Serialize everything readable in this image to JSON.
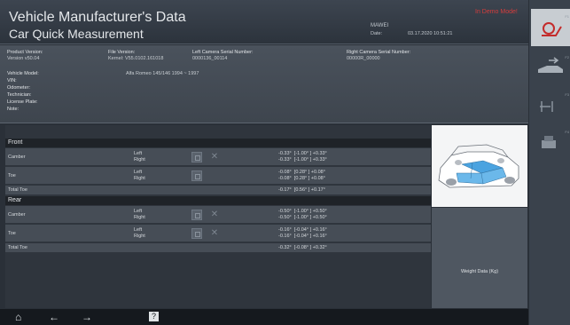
{
  "header": {
    "title_line1": "Vehicle Manufacturer's Data",
    "title_line2": "Car Quick Measurement",
    "demo_mode": "In Demo Mode!",
    "shop": "MAWEI",
    "date_label": "Date:",
    "date_value": "03.17.2020 10:51:21"
  },
  "info": {
    "product_version_label": "Product Version:",
    "product_version_value": "Version v50.04",
    "file_version_label": "File Version:",
    "file_version_value": "Kernel: V55.0102.161018",
    "left_camera_label": "Left Camera Serial Number:",
    "left_camera_value": "0000136_00114",
    "right_camera_label": "Right Camera Serial Number:",
    "right_camera_value": "00000R_00000",
    "vehicle_model_label": "Vehicle Model:",
    "vehicle_model_value": "Alfa Romeo  145/146  1994 ~ 1997",
    "vin_label": "VIN:",
    "odometer_label": "Odometer:",
    "technician_label": "Technician:",
    "license_label": "License Plate:",
    "note_label": "Note:"
  },
  "front": {
    "title": "Front",
    "camber_label": "Camber",
    "camber_left_side": "Left",
    "camber_right_side": "Right",
    "camber_left_val": "-0.33°  [-1.00° ] +0.33°",
    "camber_right_val": "-0.33°  [-1.00° ] +0.33°",
    "toe_label": "Toe",
    "toe_left_side": "Left",
    "toe_right_side": "Right",
    "toe_left_val": "-0.08°  [0.28° ] +0.08°",
    "toe_right_val": "-0.08°  [0.28° ] +0.08°",
    "total_toe_label": "Total Toe",
    "total_toe_val": "-0.17°  [0.56° ] +0.17°"
  },
  "rear": {
    "title": "Rear",
    "camber_label": "Camber",
    "camber_left_side": "Left",
    "camber_right_side": "Right",
    "camber_left_val": "-0.50°  [-1.00° ] +0.50°",
    "camber_right_val": "-0.50°  [-1.00° ] +0.50°",
    "toe_label": "Toe",
    "toe_left_side": "Left",
    "toe_right_side": "Right",
    "toe_left_val": "-0.16°  [-0.04° ] +0.16°",
    "toe_right_val": "-0.16°  [-0.04° ] +0.16°",
    "total_toe_label": "Total Toe",
    "total_toe_val": "-0.32°  [-0.08° ] +0.32°"
  },
  "weight_label": "Weight Data (Kg)",
  "sidebar": {
    "f1": "F1",
    "f2": "F2",
    "f3": "F3",
    "f4": "F4"
  },
  "colors": {
    "accent_red": "#d63c3c",
    "car_highlight": "#4aa3e0"
  },
  "icons": {
    "home": "home-icon",
    "back": "arrow-left-icon",
    "forward": "arrow-right-icon",
    "help": "help-icon",
    "wheel": "wheel-icon",
    "swap": "swap-cars-icon",
    "adjust": "adjust-icon",
    "print": "print-icon"
  }
}
